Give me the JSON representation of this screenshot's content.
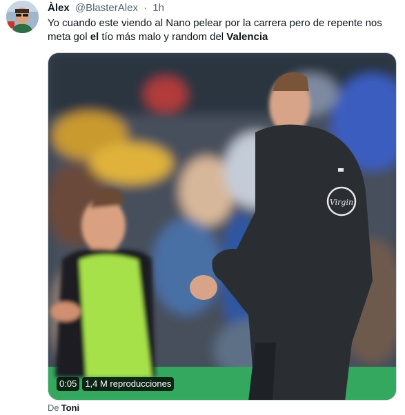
{
  "tweet": {
    "author_name": "Àlex",
    "handle": "@BlasterAlex",
    "separator": "·",
    "time": "1h",
    "text_part1": "Yo cuando este viendo al Nano pelear por la carrera pero de repente nos meta gol ",
    "text_bold1": "el",
    "text_part2": " tío más malo y random del ",
    "text_bold2": "Valencia"
  },
  "video": {
    "duration": "0:05",
    "views": "1,4 M reproducciones",
    "jacket_logo": "Virgin"
  },
  "attribution": {
    "prefix": "De",
    "author": "Toni"
  },
  "colors": {
    "text": "#0f1419",
    "secondary": "#536471",
    "border": "#cfd9de",
    "bib": "#a7e14a"
  }
}
